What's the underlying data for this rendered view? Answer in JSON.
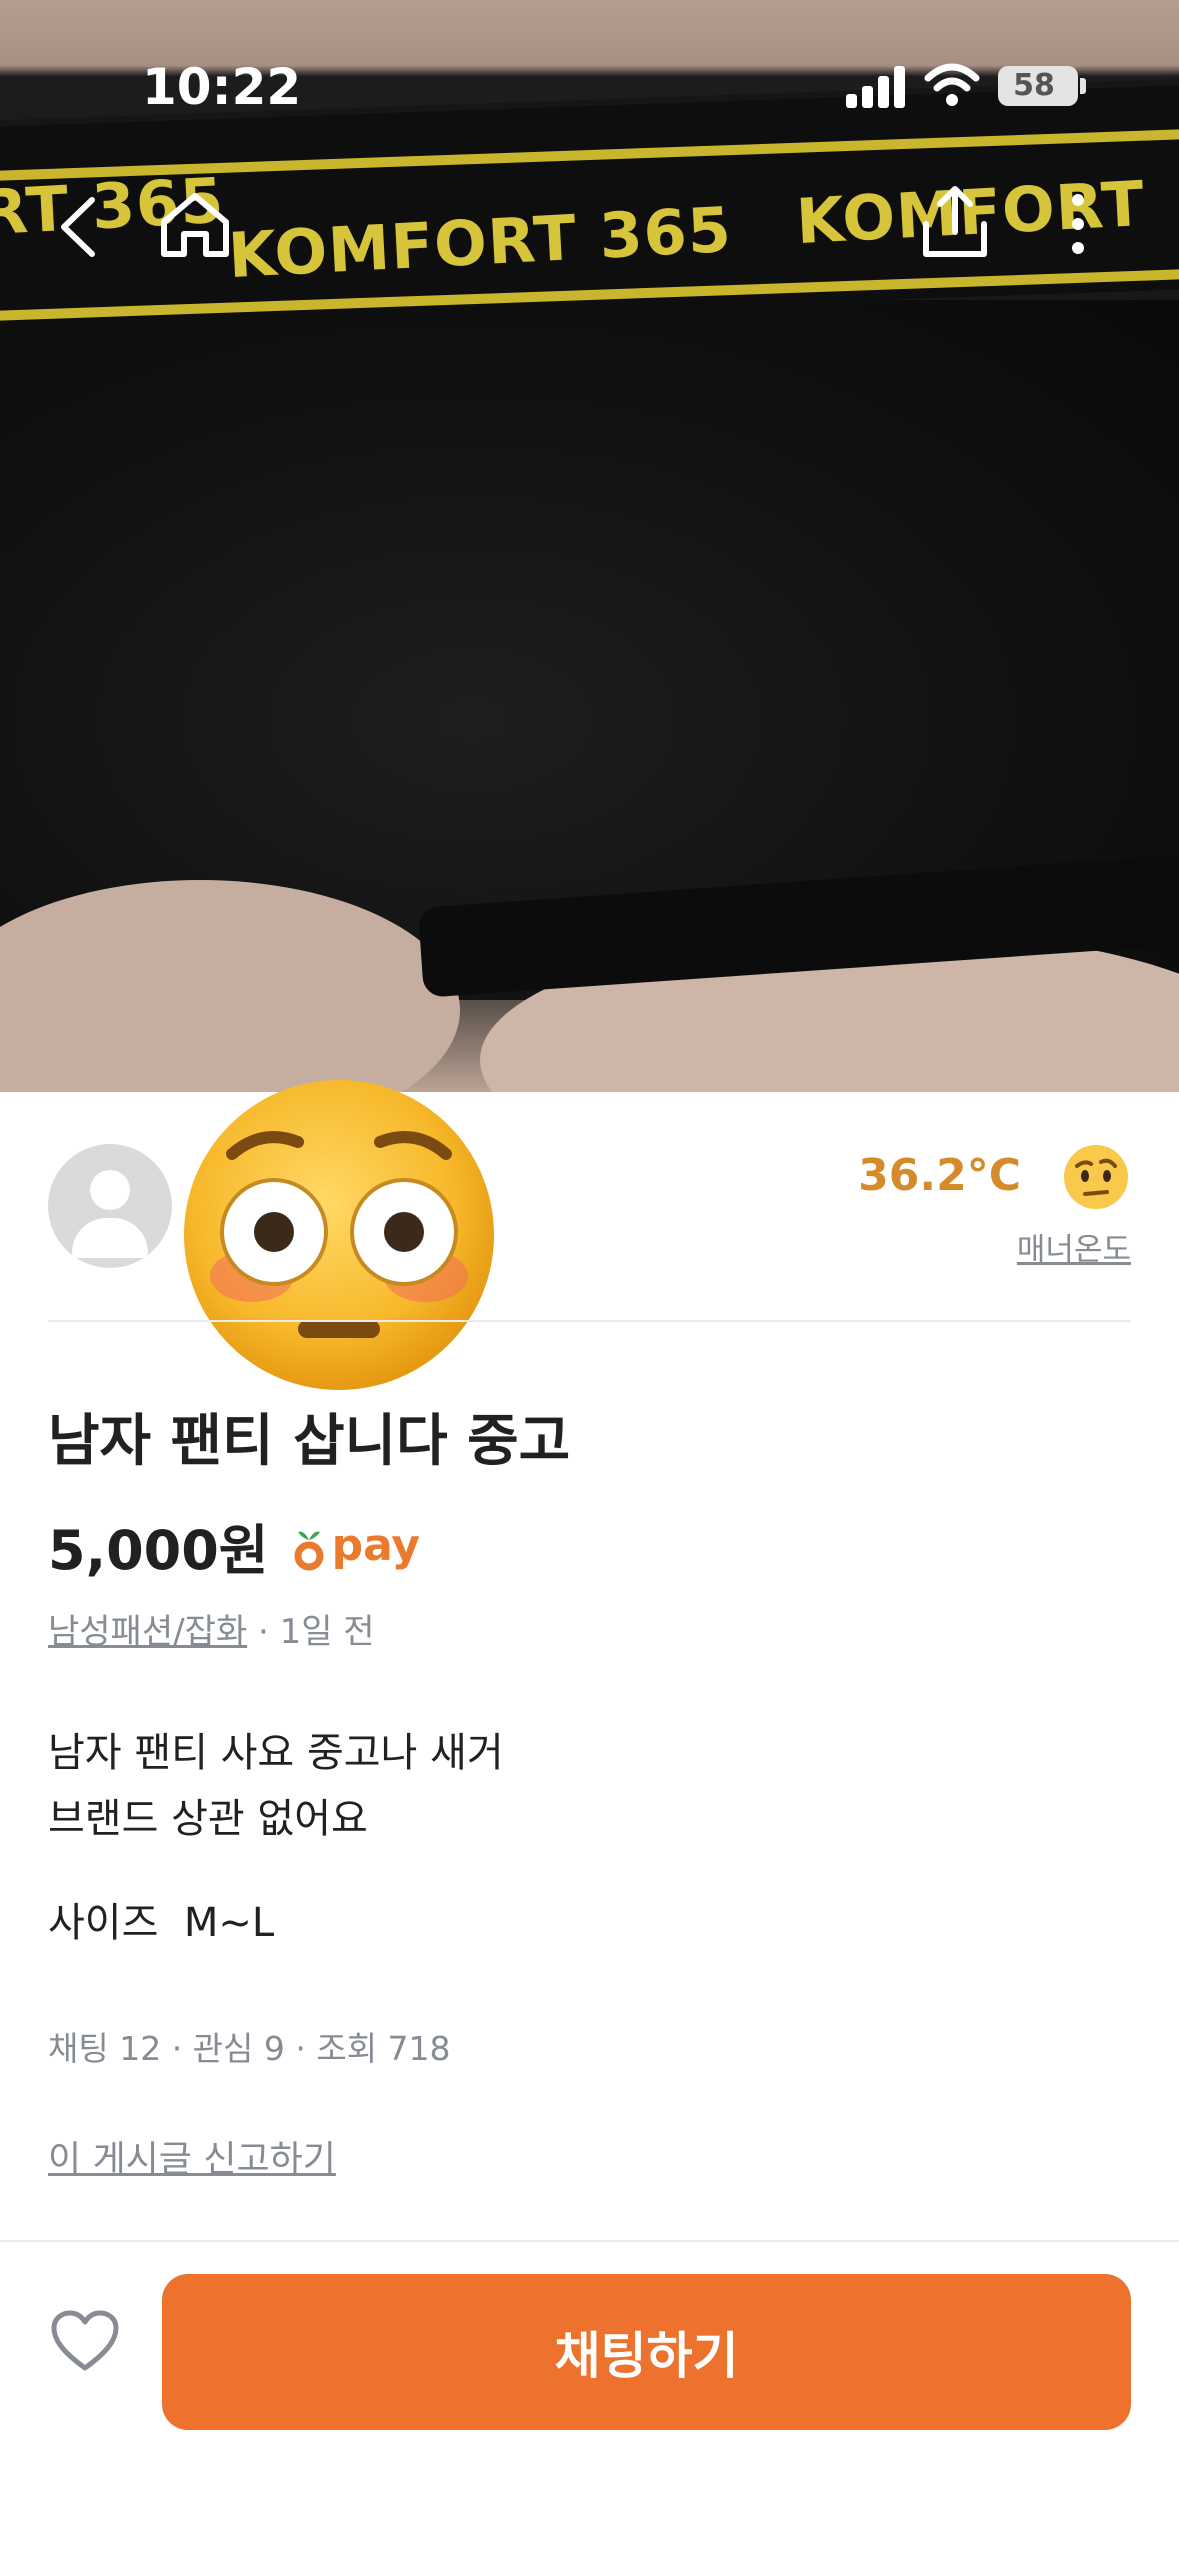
{
  "status_bar": {
    "time": "10:22",
    "battery": "58"
  },
  "hero": {
    "brand_left": "KOMFORT 365",
    "brand_right": "KOMFORT",
    "brand_edge": "RT 365"
  },
  "seller": {
    "temperature": "36.2°C",
    "temperature_label": "매너온도"
  },
  "listing": {
    "title": "남자 팬티 삽니다 중고",
    "price": "5,000원",
    "pay_label": "pay",
    "category": "남성패션/잡화",
    "time_ago": "· 1일 전",
    "description_line1": "남자 팬티 사요 중고나 새거",
    "description_line2": "브랜드 상관 없어요",
    "size_line": "사이즈  M~L",
    "stats": "채팅 12 · 관심 9 · 조회 718",
    "report": "이 게시글 신고하기"
  },
  "bottom_bar": {
    "chat_label": "채팅하기"
  },
  "colors": {
    "accent": "#ec722e",
    "temperature": "#d58b2b",
    "muted": "#868b94"
  },
  "icons": [
    "back-icon",
    "home-icon",
    "share-icon",
    "more-icon",
    "heart-icon",
    "flushed-face-emoji",
    "carrot-icon"
  ]
}
